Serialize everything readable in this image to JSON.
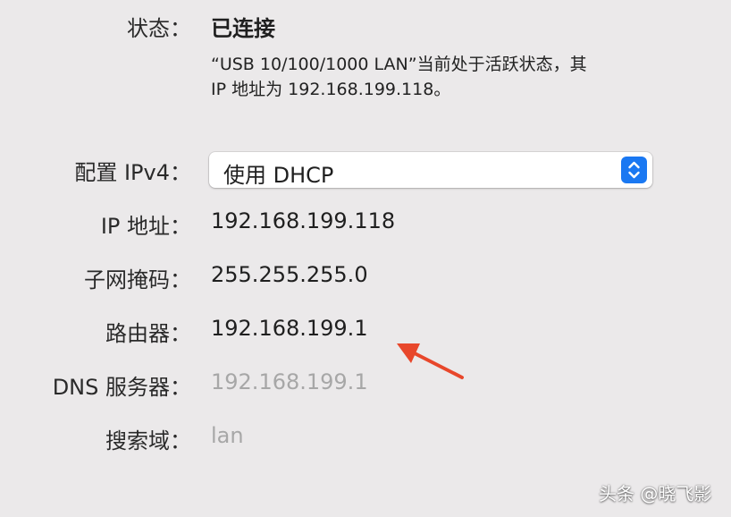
{
  "status": {
    "label": "状态：",
    "value": "已连接",
    "description_line1": "“USB 10/100/1000 LAN”当前处于活跃状态，其",
    "description_line2": "IP 地址为 192.168.199.118。"
  },
  "ipv4_config": {
    "label": "配置 IPv4：",
    "selected": "使用 DHCP"
  },
  "fields": {
    "ip_label": "IP 地址：",
    "ip_value": "192.168.199.118",
    "subnet_label": "子网掩码：",
    "subnet_value": "255.255.255.0",
    "router_label": "路由器：",
    "router_value": "192.168.199.1",
    "dns_label": "DNS 服务器：",
    "dns_value": "192.168.199.1",
    "search_domain_label": "搜索域：",
    "search_domain_value": "lan"
  },
  "watermark": "头条 @晓飞影",
  "colors": {
    "background": "#ebe9ea",
    "accent_blue": "#1a78f2",
    "annotation_arrow": "#e8472b",
    "muted_text": "#a7a7a7"
  },
  "icons": {
    "popup_stepper": "up-down-chevron-icon",
    "annotation": "red-arrow-annotation"
  }
}
